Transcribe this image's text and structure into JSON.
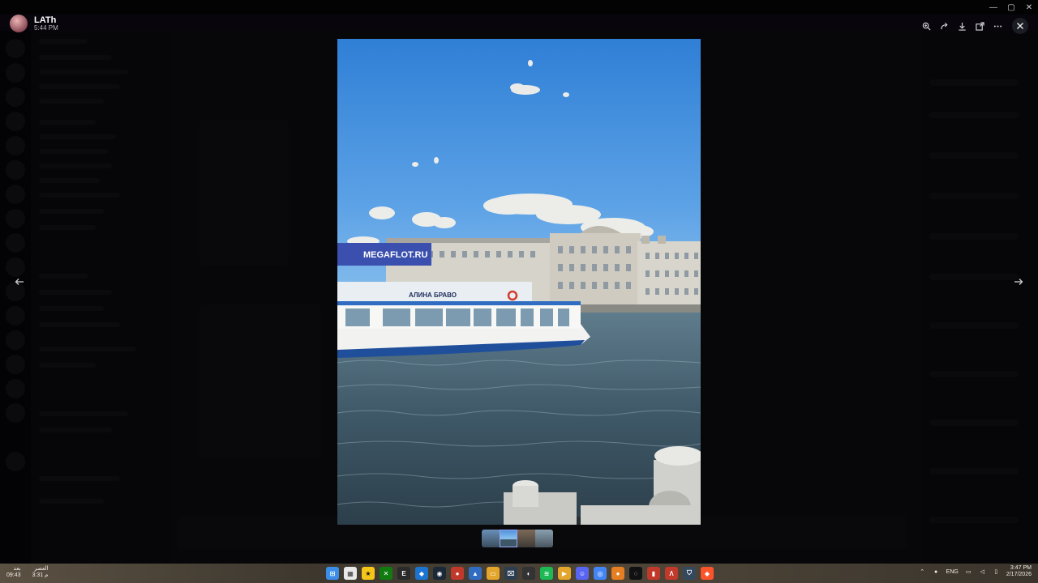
{
  "viewer": {
    "author_name": "LATh",
    "author_time": "5:44 PM",
    "actions": [
      "zoom-in-icon",
      "forward-icon",
      "download-icon",
      "open-external-icon",
      "more-icon"
    ]
  },
  "image": {
    "banner_text": "MEGAFLOT.RU",
    "boat_name": "АЛИНА БРАВО"
  },
  "gallery": {
    "thumbnails": 4,
    "active_index": 1
  },
  "taskbar": {
    "weather_top": "بعد",
    "weather_bottom": "09:43",
    "prayer_top": "العصر",
    "prayer_bottom": "3:31 م",
    "language": "ENG",
    "time": "3:47 PM",
    "date": "2/17/2026"
  },
  "colors": {
    "sky_top": "#2f7fd6",
    "sky_bottom": "#8ec3ee",
    "water": "#3e5766",
    "accent": "#5865f2"
  }
}
